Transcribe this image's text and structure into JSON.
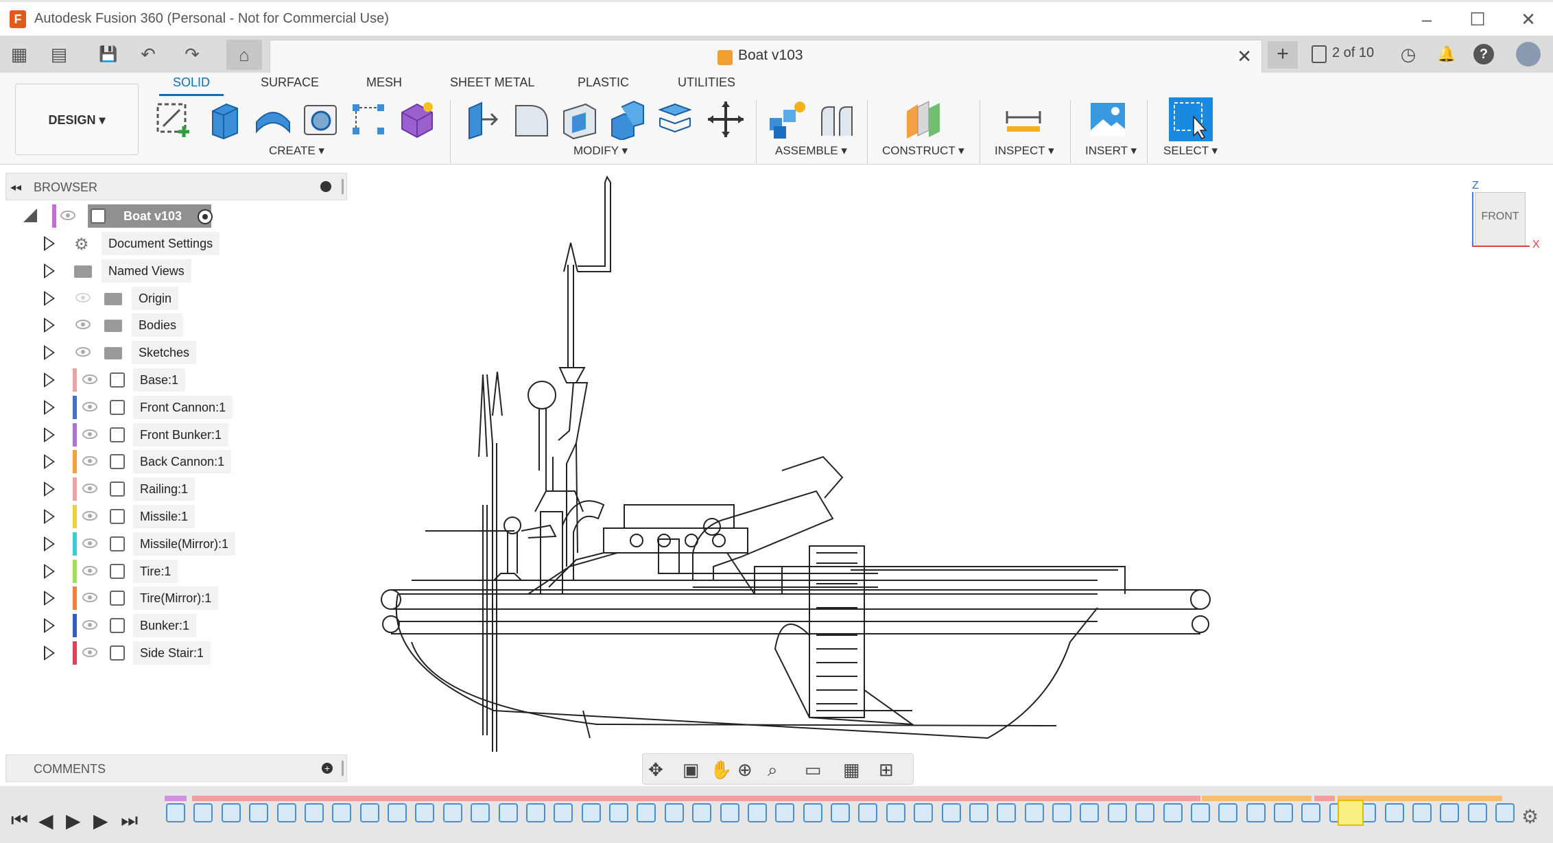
{
  "app": {
    "title": "Autodesk Fusion 360 (Personal - Not for Commercial Use)",
    "logo_letter": "F",
    "minimize_icon": "–",
    "maximize_icon": "☐",
    "close_icon": "✕"
  },
  "tabbar": {
    "grid_icon": "▦",
    "file_icon": "▤",
    "save_icon": "💾",
    "undo_icon": "↶",
    "redo_icon": "↷",
    "home_icon": "⌂",
    "doc_title": "Boat v103",
    "close_icon": "✕",
    "plus_icon": "+",
    "version_counter": "2 of 10",
    "clock_icon": "◷",
    "bell_icon": "🔔",
    "help_icon": "?",
    "avatar_icon": "●"
  },
  "ribbon": {
    "workspace": "DESIGN ▾",
    "tabs": [
      "SOLID",
      "SURFACE",
      "MESH",
      "SHEET METAL",
      "PLASTIC",
      "UTILITIES"
    ],
    "groups": {
      "create": "CREATE ▾",
      "modify": "MODIFY ▾",
      "assemble": "ASSEMBLE ▾",
      "construct": "CONSTRUCT ▾",
      "inspect": "INSPECT ▾",
      "insert": "INSERT ▾",
      "select": "SELECT ▾"
    }
  },
  "browser": {
    "title": "BROWSER",
    "collapse_icon": "◂◂",
    "root": "Boat v103",
    "items": [
      {
        "label": "Document Settings"
      },
      {
        "label": "Named Views"
      },
      {
        "label": "Origin"
      },
      {
        "label": "Bodies"
      },
      {
        "label": "Sketches"
      },
      {
        "label": "Base:1",
        "color": "#f0a0a0"
      },
      {
        "label": "Front Cannon:1",
        "color": "#4070c8"
      },
      {
        "label": "Front Bunker:1",
        "color": "#b070d8"
      },
      {
        "label": "Back Cannon:1",
        "color": "#f0a040"
      },
      {
        "label": "Railing:1",
        "color": "#f0a0a0"
      },
      {
        "label": "Missile:1",
        "color": "#f0d040"
      },
      {
        "label": "Missile(Mirror):1",
        "color": "#40c8d8"
      },
      {
        "label": "Tire:1",
        "color": "#a0e060"
      },
      {
        "label": "Tire(Mirror):1",
        "color": "#f08040"
      },
      {
        "label": "Bunker:1",
        "color": "#3060c0"
      },
      {
        "label": "Side Stair:1",
        "color": "#e04050"
      }
    ]
  },
  "comments": {
    "title": "COMMENTS"
  },
  "viewcube": {
    "face": "FRONT",
    "z_axis": "Z",
    "x_axis": "X"
  },
  "colors": {
    "accent": "#0a6ebd",
    "select_blue": "#1a8ae0",
    "timeline_pink": "#f0a0a0",
    "timeline_orange": "#f7c070"
  }
}
